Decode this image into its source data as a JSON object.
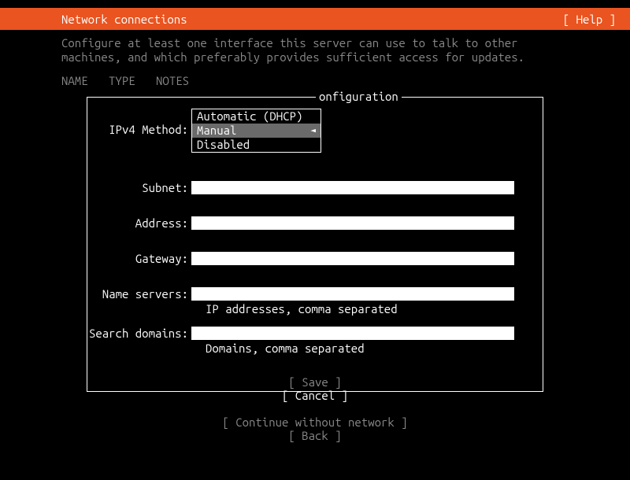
{
  "header": {
    "title": "Network connections",
    "help": "[ Help ]"
  },
  "description": "Configure at least one interface this server can use to talk to other machines, and which preferably provides sufficient access for updates.",
  "columns": {
    "name": "NAME",
    "type": "TYPE",
    "notes": "NOTES"
  },
  "panel": {
    "title": "onfiguration",
    "ipv4_label": "IPv4 Method:",
    "dropdown": {
      "options": [
        "Automatic (DHCP)",
        "Manual",
        "Disabled"
      ],
      "selected": "Manual",
      "indicator": "◄"
    },
    "fields": {
      "subnet": "Subnet:",
      "address": "Address:",
      "gateway": "Gateway:",
      "nameservers": "Name servers:",
      "nameservers_hint": "IP addresses, comma separated",
      "searchdomains": "Search domains:",
      "searchdomains_hint": "Domains, comma separated"
    },
    "buttons": {
      "save": "[ Save      ]",
      "cancel": "[ Cancel    ]"
    }
  },
  "footer": {
    "continue": "[ Continue without network ]",
    "back": "[ Back                     ]"
  }
}
